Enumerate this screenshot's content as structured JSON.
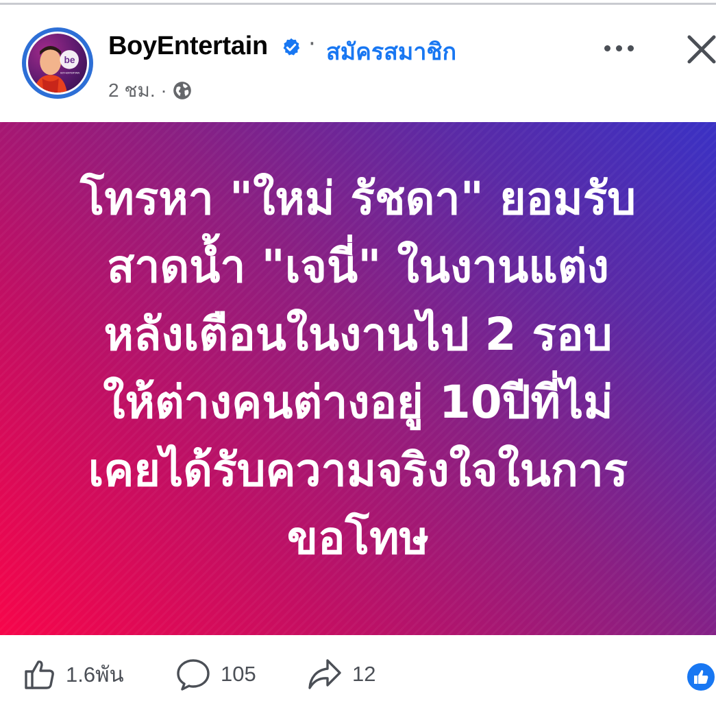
{
  "post": {
    "page_name": "BoyEntertain",
    "follow_label": "สมัครสมาชิก",
    "separator": "·",
    "time_label": "2 ชม. ·",
    "headline_lines": [
      "โทรหา \"ใหม่ รัชดา\" ยอมรับ",
      "สาดน้ำ \"เจนี่\" ในงานแต่ง",
      "หลังเตือนในงานไป 2 รอบ",
      "ให้ต่างคนต่างอยู่ 10ปีที่ไม่",
      "เคยได้รับความจริงใจในการ",
      "ขอโทษ"
    ],
    "gradient": [
      "#f7054a",
      "#8a1f82",
      "#3a31c4"
    ]
  },
  "actions": {
    "like_count": "1.6พัน",
    "comment_count": "105",
    "share_count": "12"
  },
  "colors": {
    "accent": "#1877f2",
    "text_primary": "#050505",
    "text_secondary": "#65676b"
  },
  "icons": {
    "verified": "verified-badge-icon",
    "globe": "globe-icon",
    "more": "more-options-icon",
    "close": "close-icon",
    "like": "thumbs-up-icon",
    "comment": "comment-bubble-icon",
    "share": "share-arrow-icon",
    "reaction": "like-reaction-icon"
  }
}
